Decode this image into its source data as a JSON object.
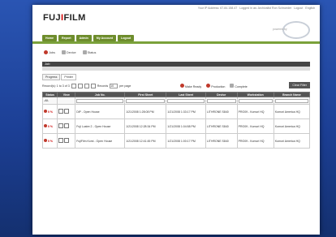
{
  "topbar": {
    "ip": "Your IP Address: 67.84.158.47",
    "logged": "Logged in as: Archivalist Ron Schroeder",
    "logout": "Logout",
    "english": "English"
  },
  "brand": {
    "logo": "FUJIFILM",
    "powered": "powered by"
  },
  "nav": [
    "Home",
    "Report",
    "Admin",
    "My Account",
    "Logout"
  ],
  "toolbar": {
    "jobs": "Jobs",
    "device": "Device",
    "status": "Status"
  },
  "panel": {
    "title": "Job"
  },
  "tabs": [
    "Progress",
    "Printer"
  ],
  "controls": {
    "records_text": "Record(s): 1 to 3 of 3",
    "records_label": "Records",
    "per_page": "per page",
    "per_page_value": "10"
  },
  "legend": {
    "make_ready": "Make Ready",
    "production": "Production",
    "complete": "Complete"
  },
  "clear_button": "Clear Filter",
  "table": {
    "headers": [
      "Status",
      "View",
      "Job No.",
      "First Sheet",
      "Last Sheet",
      "Device",
      "Workstation",
      "Branch Name"
    ],
    "filter_first": "-All-",
    "rows": [
      {
        "pct": "0 %",
        "job": "DiP - Open House",
        "first": "1/21/2008 1:28:08 PM",
        "last": "1/21/2008 1:33:17 PM",
        "device": "LITHRONE S840",
        "ws": "PRO09 - Komori HQ",
        "branch": "Komori America HQ"
      },
      {
        "pct": "0 %",
        "job": "Fuji Lustre 2 - Open House",
        "first": "1/21/2008 12:28:34 PM",
        "last": "1/21/2008 1:04:58 PM",
        "device": "LITHRONE S840",
        "ws": "PRO09 - Komori HQ",
        "branch": "Komori America HQ"
      },
      {
        "pct": "0 %",
        "job": "FujiFilm Komi - Open House",
        "first": "1/21/2008 12:41:45 PM",
        "last": "1/21/2008 1:00:17 PM",
        "device": "LITHRONE S840",
        "ws": "PRO09 - Komori HQ",
        "branch": "Komori America HQ"
      }
    ]
  }
}
